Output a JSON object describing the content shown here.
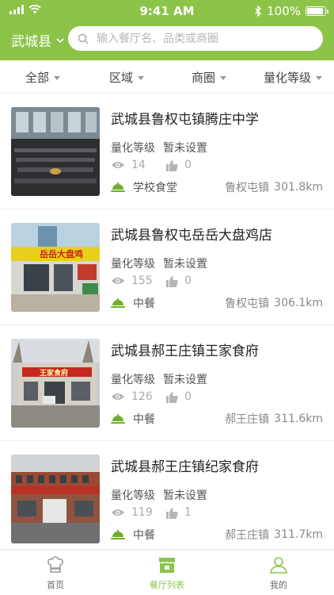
{
  "colors": {
    "brand": "#8cc449",
    "text": "#333333",
    "muted": "#aaaaaa"
  },
  "status_bar": {
    "time": "9:41 AM",
    "battery": "100%",
    "battery_level": 1.0
  },
  "header": {
    "city": "武城县",
    "search_placeholder": "输入餐厅名、品类或商圈"
  },
  "filters": [
    "全部",
    "区域",
    "商圈",
    "量化等级"
  ],
  "grade_label": "量化等级",
  "restaurants": [
    {
      "name": "武城县鲁权屯镇腾庄中学",
      "grade": "暂未设置",
      "views": "14",
      "likes": "0",
      "category": "学校食堂",
      "location": "鲁权屯镇",
      "distance": "301.8km"
    },
    {
      "name": "武城县鲁权屯岳岳大盘鸡店",
      "grade": "暂未设置",
      "views": "155",
      "likes": "0",
      "category": "中餐",
      "location": "鲁权屯镇",
      "distance": "306.1km",
      "sign_text": "岳岳大盘鸡"
    },
    {
      "name": "武城县郝王庄镇王家食府",
      "grade": "暂未设置",
      "views": "126",
      "likes": "0",
      "category": "中餐",
      "location": "郝王庄镇",
      "distance": "311.6km",
      "sign_text": "王家食府"
    },
    {
      "name": "武城县郝王庄镇纪家食府",
      "grade": "暂未设置",
      "views": "119",
      "likes": "1",
      "category": "中餐",
      "location": "郝王庄镇",
      "distance": "311.7km"
    }
  ],
  "tabs": [
    {
      "label": "首页",
      "icon": "chef-hat-icon",
      "active": false
    },
    {
      "label": "餐厅列表",
      "icon": "restaurant-icon",
      "active": true
    },
    {
      "label": "我的",
      "icon": "user-icon",
      "active": false
    }
  ]
}
